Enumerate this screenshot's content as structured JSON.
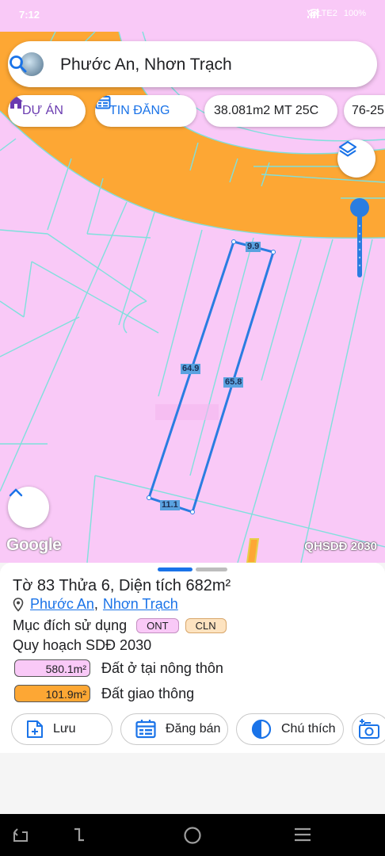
{
  "status": {
    "time": "7:12",
    "battery": "100%",
    "network": "VoLTE2"
  },
  "search": {
    "text": "Phước An, Nhơn Trạch"
  },
  "chips": [
    {
      "label": "DỰ ÁN",
      "color": "#6a3bb0"
    },
    {
      "label": "TIN ĐĂNG",
      "color": "#1a73e8"
    },
    {
      "label": "38.081m2 MT 25C",
      "color": "#202124"
    },
    {
      "label": "76-25",
      "color": "#202124"
    }
  ],
  "map": {
    "segments": {
      "top": "9.9",
      "left": "64.9",
      "right": "65.8",
      "bottom": "11.1"
    },
    "attribution": "Google",
    "layer_label": "QHSDĐ 2030",
    "colors": {
      "residential": "#f9c9f7",
      "road": "#fda734",
      "parcel_outline": "#2a7de1"
    }
  },
  "sheet": {
    "title": "Tờ 83 Thửa 6, Diện tích 682m²",
    "ward": "Phước An",
    "separator": ",",
    "district": "Nhơn Trạch",
    "purpose_label": "Mục đích sử dụng",
    "tags": [
      {
        "code": "ONT",
        "bg": "#f9c9f7",
        "border": "#c48fc1"
      },
      {
        "code": "CLN",
        "bg": "#fde3c0",
        "border": "#d8a66a"
      }
    ],
    "plan_label": "Quy hoạch SDĐ 2030",
    "land_uses": [
      {
        "area": "580.1m²",
        "name": "Đất ở tại nông thôn",
        "color": "#f9c9f7"
      },
      {
        "area": "101.9m²",
        "name": "Đất giao thông",
        "color": "#fda734"
      }
    ],
    "actions": {
      "save": "Lưu",
      "sell": "Đăng bán",
      "legend": "Chú thích"
    }
  }
}
